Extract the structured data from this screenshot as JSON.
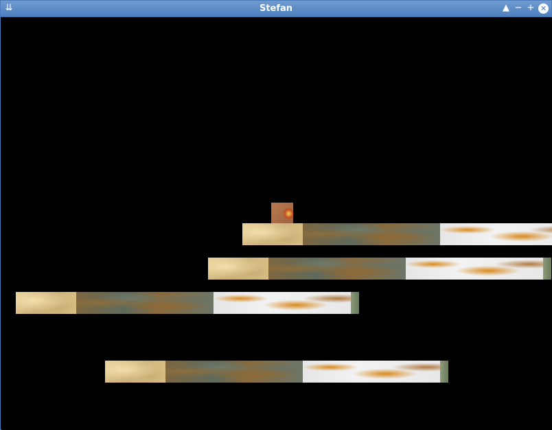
{
  "window": {
    "title": "Stefan",
    "menu_icon": "⇊",
    "shade_icon": "▲",
    "minimize_icon": "−",
    "maximize_icon": "+",
    "close_icon": "✕"
  },
  "colors": {
    "titlebar": "#5a8ac6",
    "background": "#000000"
  },
  "scene": {
    "tile_types": [
      "sand",
      "rock",
      "snow",
      "moss"
    ]
  }
}
